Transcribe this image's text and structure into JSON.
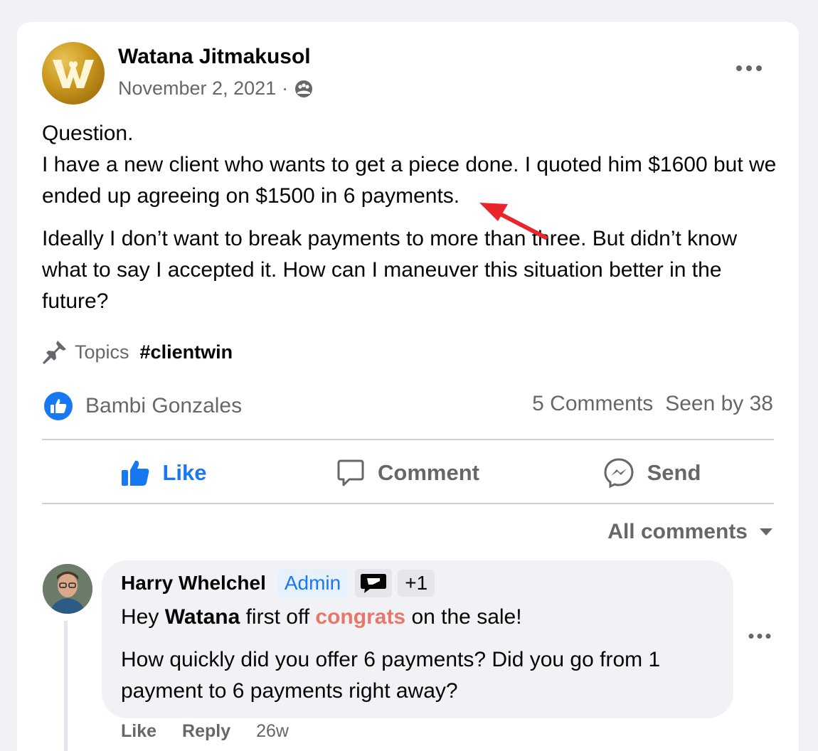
{
  "post": {
    "author": "Watana Jitmakusol",
    "date": "November 2, 2021",
    "separator": "·",
    "privacy_icon": "group-icon",
    "body_lines": [
      "Question.",
      "I have a new client who wants to get a piece done. I quoted him $1600 but we ended up agreeing on $1500 in 6 payments."
    ],
    "body_para2": "Ideally I don’t want to break payments to more than three. But didn’t know what to say I accepted it. How can I maneuver this situation better in the future?",
    "topics_label": "Topics",
    "topic_tag": "#clientwin",
    "reactor": "Bambi Gonzales",
    "comments_count": "5 Comments",
    "seen_by": "Seen by 38"
  },
  "actions": {
    "like": "Like",
    "comment": "Comment",
    "send": "Send"
  },
  "sort_label": "All comments",
  "comment": {
    "author": "Harry Whelchel",
    "badge": "Admin",
    "extra_badges": "+1",
    "line1_pre": "Hey ",
    "line1_mention": "Watana",
    "line1_mid": " first off ",
    "line1_highlight": "congrats",
    "line1_post": " on the sale!",
    "para2": "How quickly did you offer 6 payments? Did you go from 1 payment to 6 payments right away?",
    "like": "Like",
    "reply": "Reply",
    "time": "26w"
  },
  "colors": {
    "accent": "#1877f2",
    "secondary_text": "#65676b",
    "highlight": "#e8776a",
    "arrow": "#e8262b"
  }
}
